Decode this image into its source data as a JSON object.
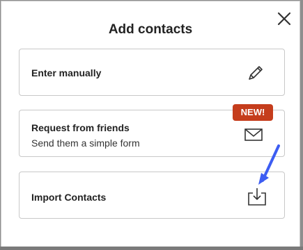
{
  "dialog": {
    "title": "Add contacts",
    "close_icon": "close-icon"
  },
  "options": [
    {
      "label": "Enter manually",
      "icon": "pencil-icon"
    },
    {
      "label": "Request from friends",
      "sublabel": "Send them a simple form",
      "icon": "envelope-icon",
      "badge": "NEW!"
    },
    {
      "label": "Import Contacts",
      "icon": "download-tray-icon"
    }
  ],
  "annotation": {
    "icon": "arrow-annotation",
    "color": "#3d5df2"
  },
  "colors": {
    "badge": "#c53d1c",
    "card_border": "#c8c8c8"
  }
}
